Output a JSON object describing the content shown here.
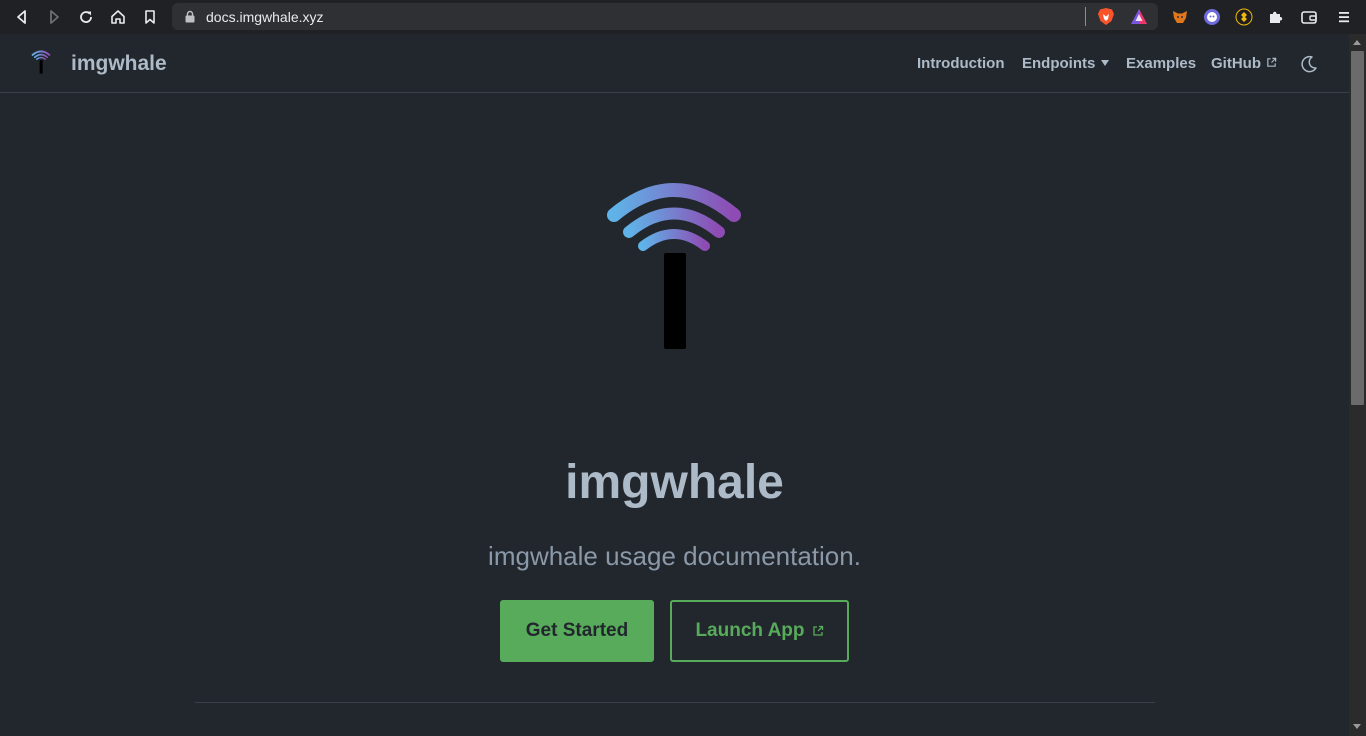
{
  "browser": {
    "url": "docs.imgwhale.xyz"
  },
  "navbar": {
    "brand": "imgwhale",
    "links": {
      "introduction": "Introduction",
      "endpoints": "Endpoints",
      "examples": "Examples",
      "github": "GitHub"
    }
  },
  "hero": {
    "title": "imgwhale",
    "tagline": "imgwhale usage documentation.",
    "primary_action": "Get Started",
    "secondary_action": "Launch App"
  },
  "colors": {
    "background": "#22272e",
    "accent": "#57ab5a",
    "text": "#adbac7",
    "logo_gradient_start": "#5fb3e8",
    "logo_gradient_end": "#8e4bb3"
  },
  "icons": {
    "back": "back-icon",
    "forward": "forward-icon",
    "reload": "reload-icon",
    "home": "home-icon",
    "bookmark": "bookmark-icon",
    "lock": "lock-icon",
    "brave": "brave-shield-icon",
    "rewards": "brave-rewards-icon",
    "extensions": "puzzle-icon",
    "wallet": "wallet-icon",
    "menu": "menu-icon",
    "theme": "moon-icon",
    "external": "external-link-icon"
  }
}
